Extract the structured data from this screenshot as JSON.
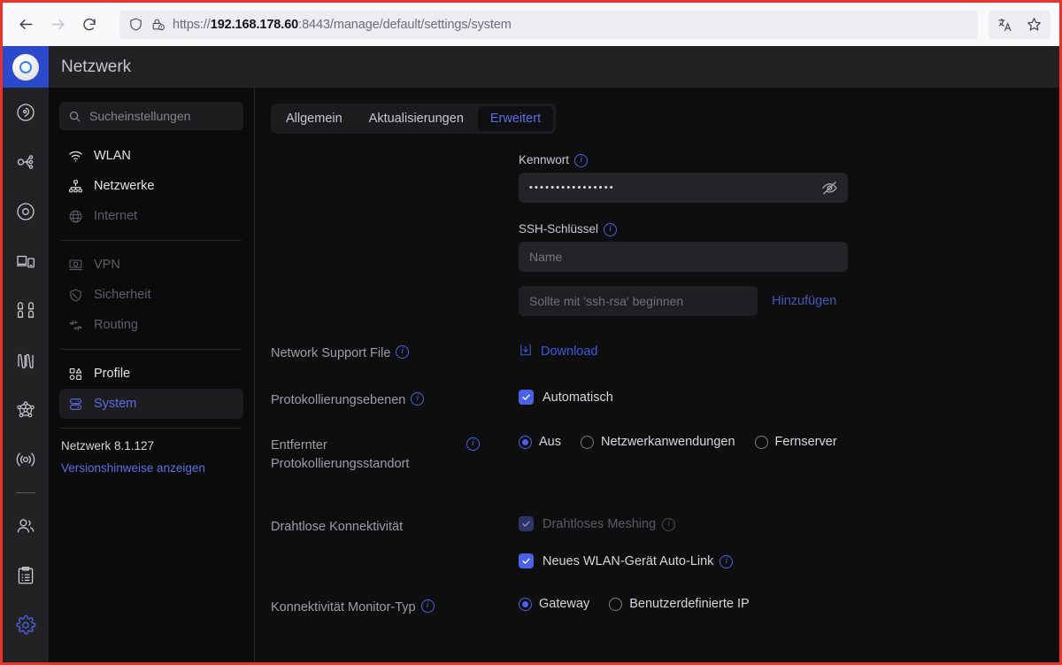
{
  "browser": {
    "back_label": "back-arrow",
    "forward_label": "forward-arrow",
    "reload_label": "reload",
    "url_prefix": "https://",
    "url_host": "192.168.178.60",
    "url_rest": ":8443/manage/default/settings/system",
    "url_full": "https://192.168.178.60:8443/manage/default/settings/system",
    "translate_label": "translate",
    "bookmark_label": "bookmark"
  },
  "header": {
    "title": "Netzwerk"
  },
  "rail": {
    "items": [
      {
        "name": "dashboard-icon"
      },
      {
        "name": "topology-icon"
      },
      {
        "name": "devices-icon"
      },
      {
        "name": "clients-icon"
      },
      {
        "name": "apps-icon"
      },
      {
        "name": "insights-icon"
      },
      {
        "name": "network-mesh-icon"
      },
      {
        "name": "wifiman-icon"
      },
      {
        "name": "users-icon"
      },
      {
        "name": "logs-icon"
      },
      {
        "name": "settings-icon"
      }
    ]
  },
  "sidebar": {
    "search": {
      "placeholder": "Sucheinstellungen"
    },
    "group1": [
      {
        "label": "WLAN",
        "icon": "wifi-icon",
        "state": "normal"
      },
      {
        "label": "Netzwerke",
        "icon": "network-icon",
        "state": "normal"
      },
      {
        "label": "Internet",
        "icon": "globe-icon",
        "state": "muted"
      }
    ],
    "group2": [
      {
        "label": "VPN",
        "icon": "vpn-icon",
        "state": "muted"
      },
      {
        "label": "Sicherheit",
        "icon": "shield-icon",
        "state": "muted"
      },
      {
        "label": "Routing",
        "icon": "routing-icon",
        "state": "muted"
      }
    ],
    "group3": [
      {
        "label": "Profile",
        "icon": "profile-icon",
        "state": "normal"
      },
      {
        "label": "System",
        "icon": "system-icon",
        "state": "active"
      }
    ],
    "version": "Netzwerk 8.1.127",
    "release_notes": "Versionshinweise anzeigen"
  },
  "main": {
    "tabs": [
      {
        "label": "Allgemein",
        "active": false
      },
      {
        "label": "Aktualisierungen",
        "active": false
      },
      {
        "label": "Erweitert",
        "active": true
      }
    ],
    "password": {
      "label": "Kennwort",
      "value": "••••••••••••••••",
      "reveal_icon": "eye-off-icon"
    },
    "ssh": {
      "label": "SSH-Schlüssel",
      "name_placeholder": "Name",
      "key_placeholder": "Sollte mit 'ssh-rsa' beginnen",
      "add_label": "Hinzufügen"
    },
    "support_file": {
      "label": "Network Support File",
      "download_label": "Download",
      "download_icon": "download-icon"
    },
    "log_levels": {
      "label": "Protokollierungsebenen",
      "checkbox_label": "Automatisch",
      "checked": true
    },
    "remote_log": {
      "label": "Entfernter Protokollierungsstandort",
      "options": [
        {
          "label": "Aus",
          "selected": true
        },
        {
          "label": "Netzwerkanwendungen",
          "selected": false
        },
        {
          "label": "Fernserver",
          "selected": false
        }
      ]
    },
    "wireless": {
      "label": "Drahtlose Konnektivität",
      "mesh": {
        "label": "Drahtloses Meshing",
        "checked": true,
        "disabled": true
      },
      "autolink": {
        "label": "Neues WLAN-Gerät Auto-Link",
        "checked": true,
        "disabled": false
      }
    },
    "monitor": {
      "label": "Konnektivität Monitor-Typ",
      "options": [
        {
          "label": "Gateway",
          "selected": true
        },
        {
          "label": "Benutzerdefinierte IP",
          "selected": false
        }
      ]
    }
  },
  "colors": {
    "accent": "#4a62e8",
    "link": "#5b6fe8",
    "frame": "#e8342a",
    "rail_active": "#2b4acb"
  }
}
